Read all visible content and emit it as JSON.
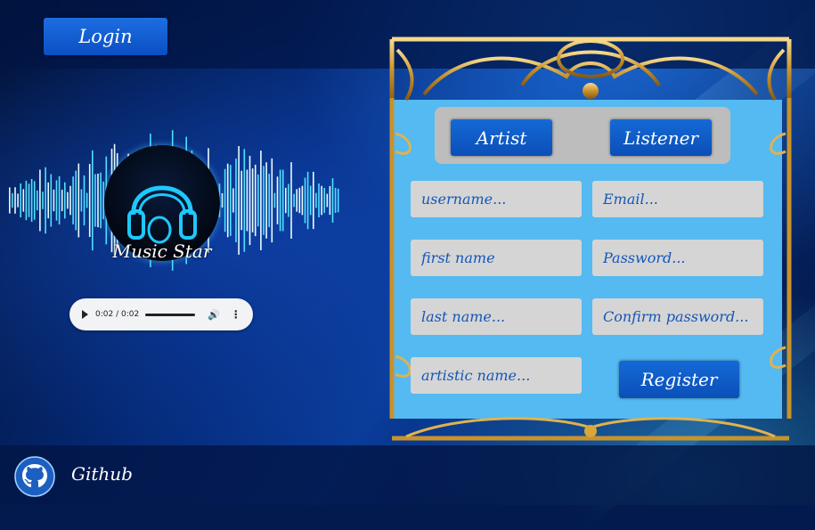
{
  "header": {
    "login_label": "Login"
  },
  "hero": {
    "logo_title": "Music Star",
    "player": {
      "time": "0:02 / 0:02"
    }
  },
  "form": {
    "role_artist": "Artist",
    "role_listener": "Listener",
    "fields": {
      "username": "username...",
      "email": "Email...",
      "first_name": "first name",
      "password": "Password...",
      "last_name": "last name...",
      "confirm_password": "Confirm password...",
      "artistic_name": "artistic name..."
    },
    "register_label": "Register"
  },
  "footer": {
    "github_label": "Github"
  },
  "colors": {
    "accent_blue": "#0b4fb8",
    "panel_blue": "#54baf1",
    "field_gray": "#d5d5d5",
    "gold": "#d9a637"
  }
}
